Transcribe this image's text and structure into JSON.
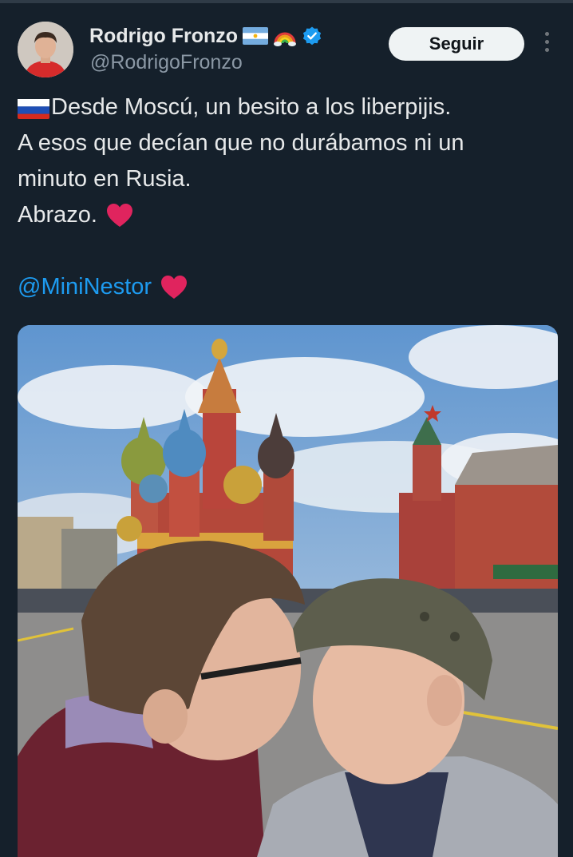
{
  "header": {
    "display_name": "Rodrigo Fronzo",
    "handle": "@RodrigoFronzo",
    "badges": [
      "argentina-flag",
      "rainbow",
      "verified-badge"
    ]
  },
  "actions": {
    "follow_label": "Seguir"
  },
  "tweet": {
    "line1": "Desde Moscú, un besito a los liberpijis.",
    "line2": "A esos que decían que no durábamos ni un",
    "line3": "minuto en Rusia.",
    "line4": "Abrazo.",
    "mention": "@MiniNestor"
  },
  "colors": {
    "background": "#15202b",
    "text": "#e7e9ea",
    "secondary_text": "#8b98a5",
    "link": "#1d9bf0",
    "verified": "#1d9bf0",
    "heart": "#e0245e"
  }
}
